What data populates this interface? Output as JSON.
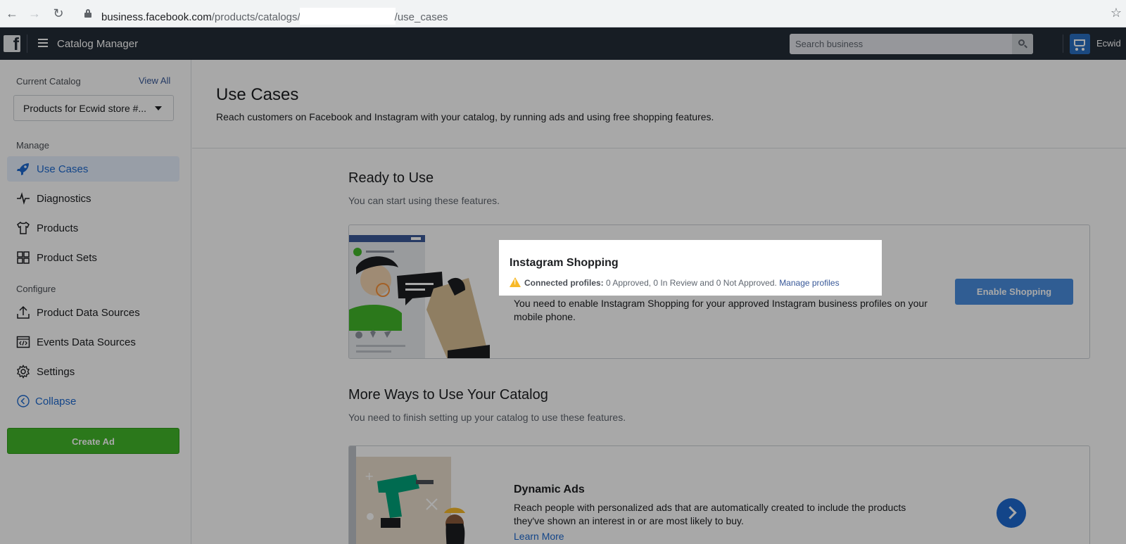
{
  "browser": {
    "url_host": "business.facebook.com",
    "url_path_prefix": "/products/catalogs/",
    "url_path_suffix": "/use_cases"
  },
  "topbar": {
    "app_title": "Catalog Manager",
    "search_placeholder": "Search business",
    "business_name": "Ecwid"
  },
  "sidebar": {
    "current_catalog_label": "Current Catalog",
    "view_all": "View All",
    "catalog_selected": "Products for Ecwid store #...",
    "manage_label": "Manage",
    "manage_items": [
      {
        "label": "Use Cases",
        "icon": "rocket-icon",
        "active": true
      },
      {
        "label": "Diagnostics",
        "icon": "pulse-icon"
      },
      {
        "label": "Products",
        "icon": "tshirt-icon"
      },
      {
        "label": "Product Sets",
        "icon": "grid-icon"
      }
    ],
    "configure_label": "Configure",
    "configure_items": [
      {
        "label": "Product Data Sources",
        "icon": "upload-icon"
      },
      {
        "label": "Events Data Sources",
        "icon": "code-window-icon"
      },
      {
        "label": "Settings",
        "icon": "gear-icon"
      }
    ],
    "collapse": "Collapse",
    "create_ad": "Create Ad"
  },
  "main": {
    "title": "Use Cases",
    "description": "Reach customers on Facebook and Instagram with your catalog, by running ads and using free shopping features.",
    "ready": {
      "title": "Ready to Use",
      "description": "You can start using these features."
    },
    "instagram": {
      "title": "Instagram Shopping",
      "profiles_label": "Connected profiles:",
      "profiles_status": " 0 Approved, 0 In Review and 0 Not Approved. ",
      "manage_profiles": "Manage profiles",
      "text": "You need to enable Instagram Shopping for your approved Instagram business profiles on your mobile phone.",
      "button": "Enable Shopping"
    },
    "more": {
      "title": "More Ways to Use Your Catalog",
      "description": "You need to finish setting up your catalog to use these features."
    },
    "dynamic_ads": {
      "title": "Dynamic Ads",
      "text": "Reach people with personalized ads that are automatically created to include the products they've shown an interest in or are most likely to buy.",
      "learn_more": "Learn More"
    }
  },
  "colors": {
    "accent": "#1d6ad0",
    "topbar": "#242c38",
    "create_ad": "#42b72a"
  }
}
